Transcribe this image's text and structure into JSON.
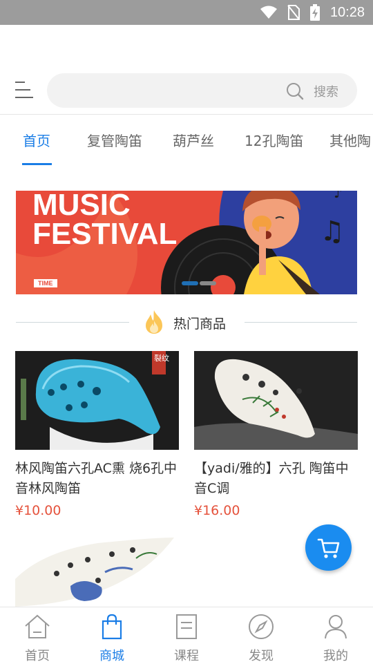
{
  "status_bar": {
    "time": "10:28"
  },
  "search": {
    "placeholder": "搜索"
  },
  "category_tabs": [
    {
      "label": "首页",
      "active": true
    },
    {
      "label": "复管陶笛"
    },
    {
      "label": "葫芦丝"
    },
    {
      "label": "12孔陶笛"
    },
    {
      "label": "其他陶"
    }
  ],
  "banner": {
    "line1": "MUSIC",
    "line2": "FESTIVAL",
    "tag": "TIME",
    "slide_count": 2,
    "active_slide": 1
  },
  "section": {
    "title": "热门商品"
  },
  "products": [
    {
      "name": "林风陶笛六孔AC熏 烧6孔中音林风陶笛",
      "price": "¥10.00",
      "image_badge": "裂纹"
    },
    {
      "name": "【yadi/雅的】六孔 陶笛中音C调",
      "price": "¥16.00"
    }
  ],
  "bottom_nav": [
    {
      "label": "首页",
      "icon": "home-icon"
    },
    {
      "label": "商城",
      "icon": "shopping-bag-icon",
      "active": true
    },
    {
      "label": "课程",
      "icon": "document-icon"
    },
    {
      "label": "发现",
      "icon": "compass-icon"
    },
    {
      "label": "我的",
      "icon": "person-icon"
    }
  ],
  "colors": {
    "accent": "#1a7de6",
    "price": "#e5533d",
    "fab": "#1a8cf0"
  }
}
